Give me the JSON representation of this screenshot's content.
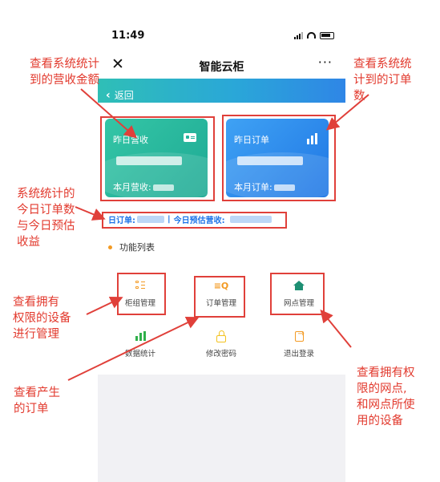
{
  "status_bar": {
    "time": "11:49"
  },
  "nav": {
    "close": "✕",
    "title": "智能云柜",
    "more": "···"
  },
  "back": {
    "chevron": "‹",
    "label": "返回"
  },
  "cards": {
    "revenue": {
      "label": "昨日营收",
      "month_label": "本月营收:"
    },
    "orders": {
      "label": "昨日订单",
      "month_label": "本月订单:"
    }
  },
  "today": {
    "orders_label": "日订单:",
    "separator": "|",
    "revenue_label": "今日预估营收:"
  },
  "section": {
    "title": "功能列表"
  },
  "functions": [
    {
      "label": "柜组管理",
      "icon": "cabinet-icon"
    },
    {
      "label": "订单管理",
      "icon": "order-search-icon"
    },
    {
      "label": "网点管理",
      "icon": "house-icon"
    },
    {
      "label": "数据统计",
      "icon": "stats-icon"
    },
    {
      "label": "修改密码",
      "icon": "lock-icon"
    },
    {
      "label": "退出登录",
      "icon": "logout-icon"
    }
  ],
  "annotations": {
    "revenue": [
      "查看系统统计",
      "到的营收金额"
    ],
    "orders": [
      "查看系统统",
      "计到的订单",
      "数"
    ],
    "today": [
      "系统统计的",
      "今日订单数",
      "与今日预估",
      "收益"
    ],
    "cabinet": [
      "查看拥有",
      "权限的设备",
      "进行管理"
    ],
    "order_mgmt": [
      "查看产生",
      "的订单"
    ],
    "outlet": [
      "查看拥有权",
      "限的网点,",
      "和网点所使",
      "用的设备"
    ]
  },
  "colors": {
    "annotation_red": "#e23a2e",
    "revenue_card": "#2bb79f",
    "orders_card": "#2a86ec",
    "accent_blue": "#1b73e8",
    "accent_orange": "#f39a23"
  }
}
